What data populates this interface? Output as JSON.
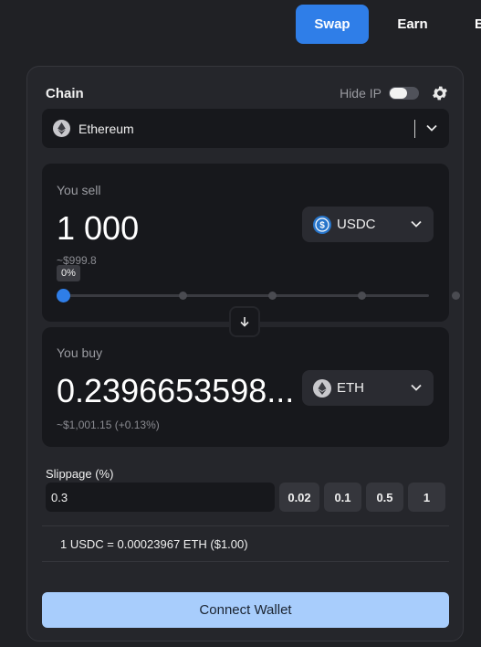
{
  "nav": {
    "tabs": [
      {
        "label": "Swap",
        "active": true
      },
      {
        "label": "Earn",
        "active": false
      },
      {
        "label": "Bo",
        "active": false
      }
    ]
  },
  "chain": {
    "label": "Chain",
    "hide_ip_label": "Hide IP",
    "hide_ip_enabled": false,
    "selected": "Ethereum",
    "settings_icon": "gear-icon"
  },
  "sell": {
    "label": "You sell",
    "amount": "1 000",
    "usd_value": "~$999.8",
    "token": "USDC",
    "token_icon": "usdc-icon",
    "percent_badge": "0%",
    "percent": 0
  },
  "buy": {
    "label": "You buy",
    "amount": "0.2396653598...",
    "usd_value": "~$1,001.15 (+0.13%)",
    "token": "ETH",
    "token_icon": "eth-icon"
  },
  "slippage": {
    "label": "Slippage (%)",
    "value": "0.3",
    "options": [
      "0.02",
      "0.1",
      "0.5",
      "1"
    ]
  },
  "rate": "1 USDC = 0.00023967 ETH ($1.00)",
  "connect_label": "Connect Wallet",
  "colors": {
    "accent": "#2f7ee8",
    "connect_bg": "#a8cdfc",
    "background": "#202125",
    "card": "#25262b",
    "panel": "#17181c"
  }
}
